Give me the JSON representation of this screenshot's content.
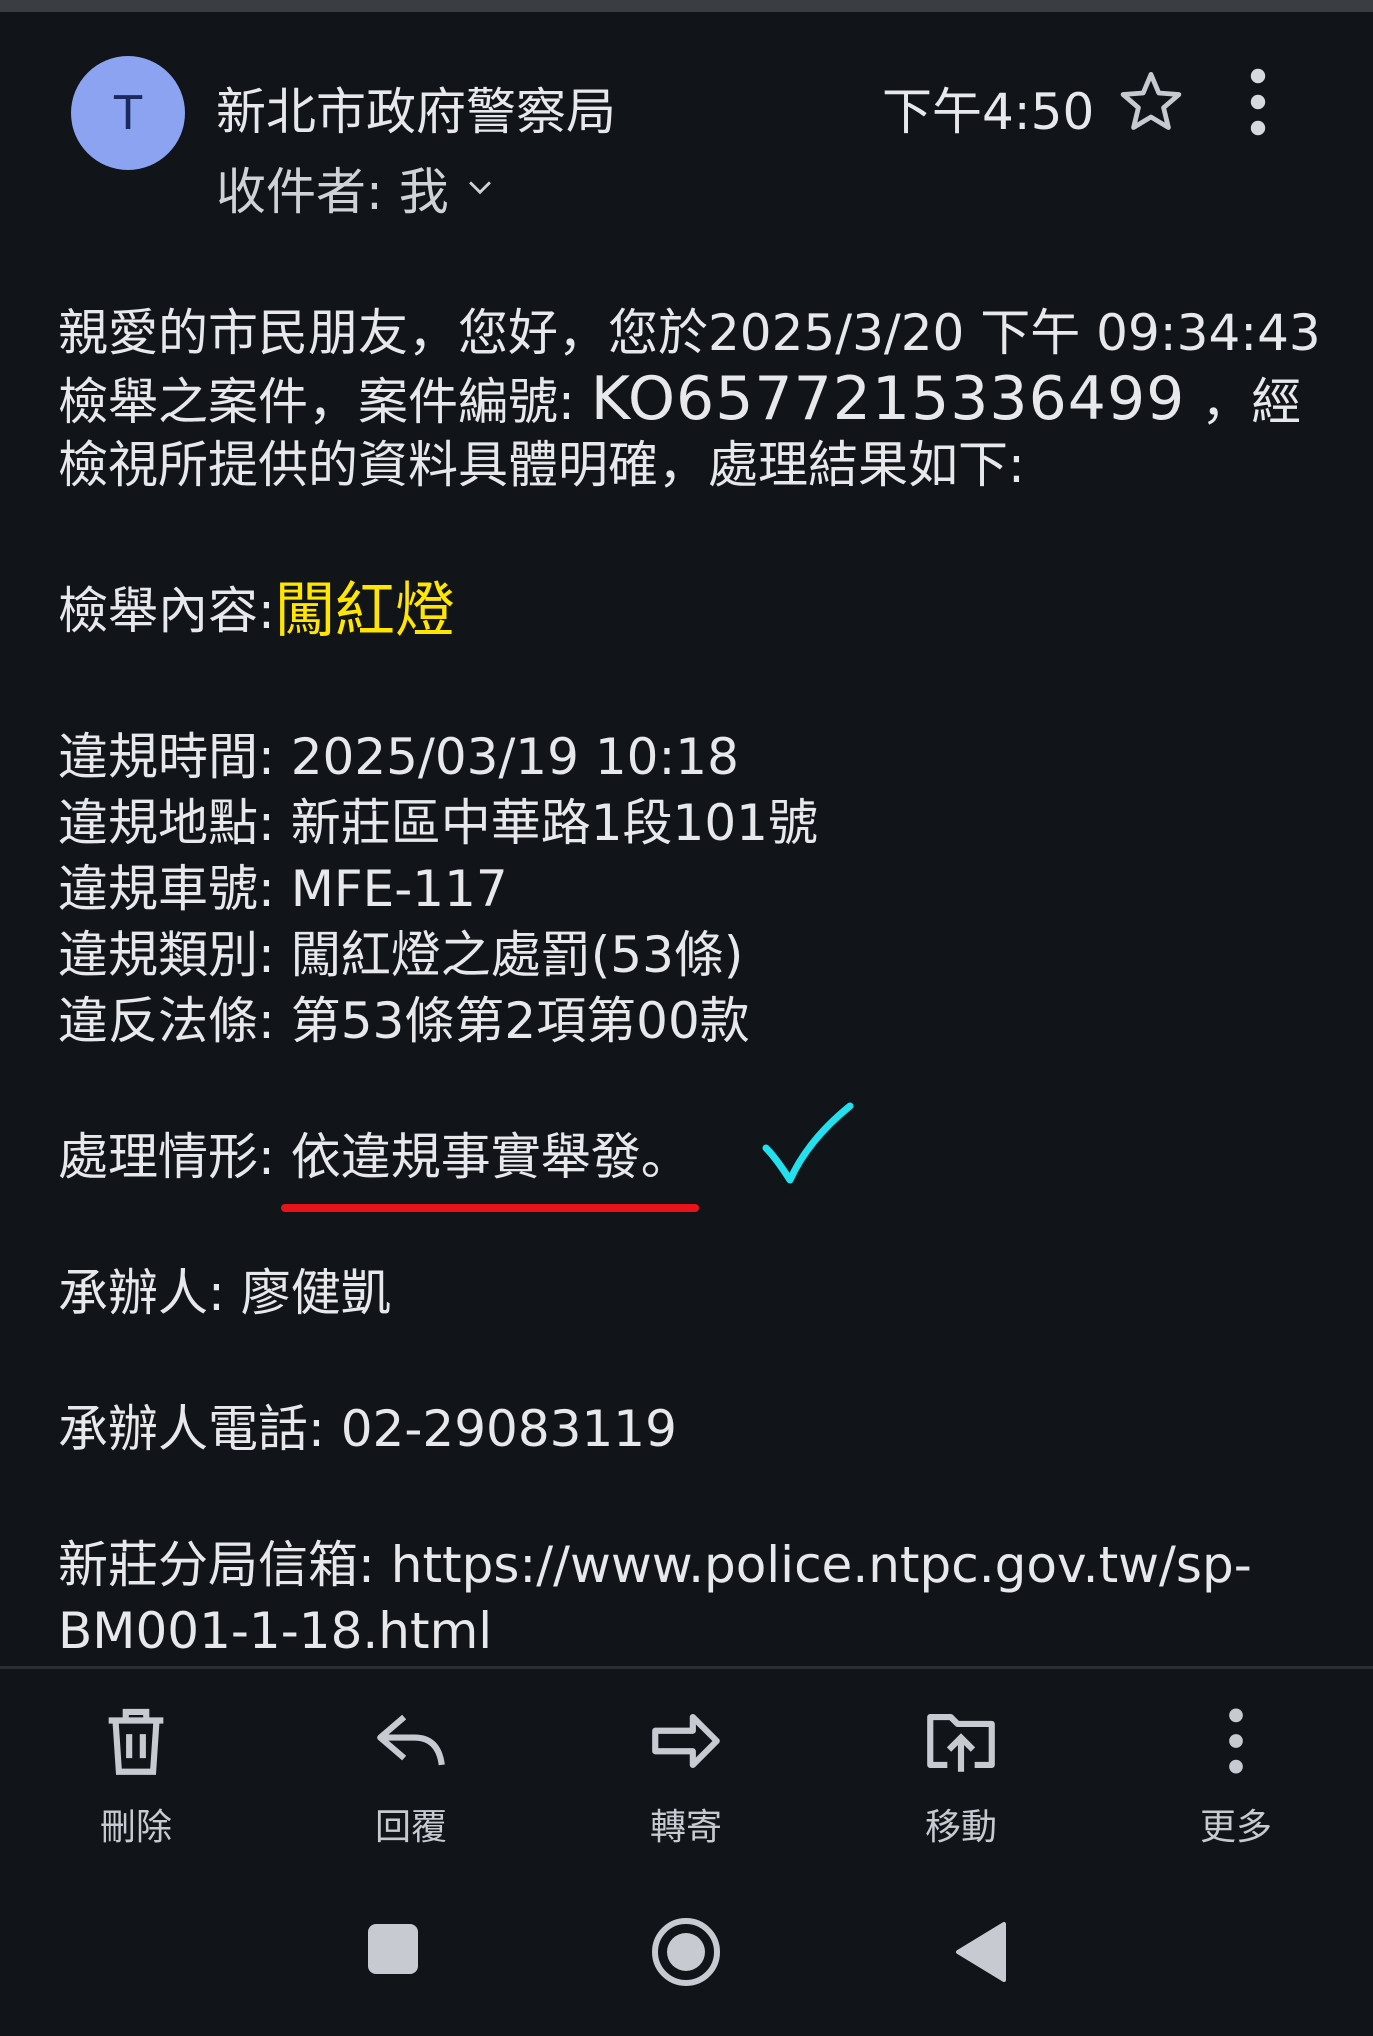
{
  "header": {
    "avatar_letter": "T",
    "sender": "新北市政府警察局",
    "recipient": "收件者: 我",
    "time": "下午4:50"
  },
  "body": {
    "greeting": "親愛的市民朋友，您好，您於2025/3/20 下午 09:34:43",
    "case_prefix": "檢舉之案件，案件編號: ",
    "case_number": "KO6577215336499",
    "case_suffix": " ，經",
    "line3": "檢視所提供的資料具體明確，處理結果如下:",
    "report_label": "檢舉內容: ",
    "report_value": "闖紅燈",
    "details": [
      {
        "label": "違規時間: ",
        "value": "2025/03/19 10:18"
      },
      {
        "label": "違規地點: ",
        "value": "新莊區中華路1段101號"
      },
      {
        "label": "違規車號: ",
        "value": "MFE-117"
      },
      {
        "label": "違規類別: ",
        "value": "闖紅燈之處罰(53條)"
      },
      {
        "label": "違反法條: ",
        "value": "第53條第2項第00款"
      }
    ],
    "status_label": "處理情形: ",
    "status_value": "依違規事實舉發。",
    "handler_label": "承辦人: ",
    "handler_value": "廖健凱",
    "phone_label": "承辦人電話: ",
    "phone_value": "02-29083119",
    "mailbox_label": "新莊分局信箱: ",
    "mailbox_url_1": "https://www.police.ntpc.gov.tw/sp-",
    "mailbox_url_2": "BM001-1-18.html"
  },
  "actions": [
    {
      "label": "刪除",
      "icon": "trash-icon"
    },
    {
      "label": "回覆",
      "icon": "reply-icon"
    },
    {
      "label": "轉寄",
      "icon": "forward-icon"
    },
    {
      "label": "移動",
      "icon": "move-icon"
    },
    {
      "label": "更多",
      "icon": "more-vert-icon"
    }
  ],
  "colors": {
    "background": "#111419",
    "highlight_yellow": "#ffe500",
    "underline_red": "#e8141a",
    "checkmark_cyan": "#22e0ee",
    "avatar": "#8ba3f0"
  }
}
